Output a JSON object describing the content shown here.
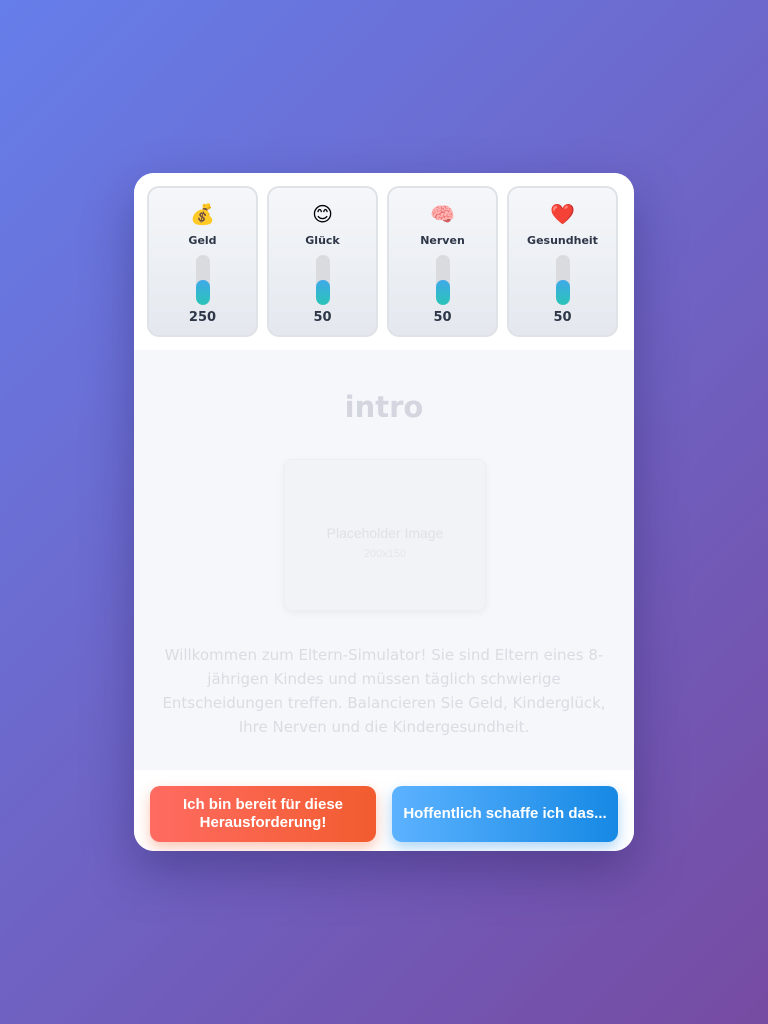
{
  "stats": [
    {
      "icon": "💰",
      "icon_name": "money-bag-icon",
      "label": "Geld",
      "value": "250",
      "level": 0.5
    },
    {
      "icon": "😊",
      "icon_name": "smiling-face-icon",
      "label": "Glück",
      "value": "50",
      "level": 0.5
    },
    {
      "icon": "🧠",
      "icon_name": "brain-icon",
      "label": "Nerven",
      "value": "50",
      "level": 0.5
    },
    {
      "icon": "❤️",
      "icon_name": "heart-icon",
      "label": "Gesundheit",
      "value": "50",
      "level": 0.5
    }
  ],
  "scene": {
    "title": "intro",
    "image_label": "Placeholder Image",
    "image_size": "200x150",
    "text": "Willkommen zum Eltern-Simulator! Sie sind Eltern eines 8-jährigen Kindes und müssen täglich schwierige Entscheidungen treffen. Balancieren Sie Geld, Kinderglück, Ihre Nerven und die Kindergesundheit."
  },
  "choices": {
    "primary_label": "Ich bin bereit für diese Herausforderung!",
    "secondary_label": "Hoffentlich schaffe ich das..."
  },
  "colors": {
    "background_start": "#667eea",
    "background_end": "#764ba2",
    "bar_fill": "#2cc4b8",
    "primary_button": "#f25c2f",
    "secondary_button": "#1689e4"
  }
}
